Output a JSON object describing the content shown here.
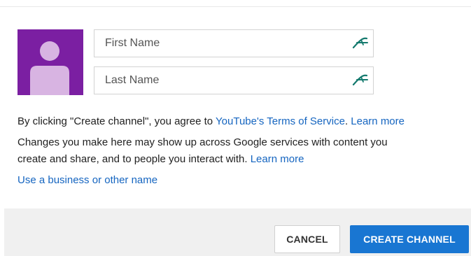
{
  "form": {
    "first_name": {
      "value": "",
      "placeholder": "First Name"
    },
    "last_name": {
      "value": "",
      "placeholder": "Last Name"
    },
    "input_icon": "autofill-pen-icon",
    "avatar_icon": "default-avatar-icon"
  },
  "terms": {
    "prefix": "By clicking \"Create channel\", you agree to ",
    "tos_link": "YouTube's Terms of Service",
    "separator": ". ",
    "learn_more_1": "Learn more"
  },
  "notice": {
    "line1": "Changes you make here may show up across Google services with content you",
    "line2": "create and share, and to people you interact with. ",
    "learn_more_2": "Learn more"
  },
  "business_link": "Use a business or other name",
  "footer": {
    "cancel_label": "CANCEL",
    "create_label": "CREATE CHANNEL"
  },
  "colors": {
    "avatar_bg": "#7b1fa2",
    "avatar_figure": "#d8b4e2",
    "link": "#1565c0",
    "primary_button": "#1976d2",
    "footer_bg": "#f0f0f0"
  }
}
